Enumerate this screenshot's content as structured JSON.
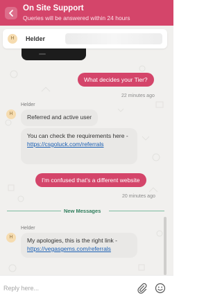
{
  "header": {
    "title": "On Site Support",
    "subtitle": "Queries will be answered within 24 hours",
    "back_icon": "chevron-left-icon",
    "background": "#d4456a"
  },
  "agent_card": {
    "initial": "H",
    "name": "Helder"
  },
  "messages": [
    {
      "direction": "outgoing",
      "text": "What decides your Tier?",
      "time": "22 minutes ago"
    },
    {
      "direction": "incoming",
      "sender": "Helder",
      "avatar": "H",
      "text": "Referred and active user"
    },
    {
      "direction": "incoming",
      "text": "You can check the requirements here -",
      "link": "https://csgoluck.com/referrals"
    },
    {
      "direction": "outgoing",
      "text": "I'm confused that's a different website",
      "time": "20 minutes ago"
    },
    {
      "direction": "incoming",
      "sender": "Helder",
      "avatar": "H",
      "text": "My apologies, this is the right link -",
      "link": "https://vegasgems.com/referrals"
    }
  ],
  "divider": {
    "label": "New Messages",
    "color": "#2e7d5b"
  },
  "composer": {
    "placeholder": "Reply here...",
    "attach_icon": "paperclip-icon",
    "emoji_icon": "smiley-icon"
  },
  "colors": {
    "accent": "#d4456a",
    "incoming_bubble": "#e9e8e6",
    "chat_background": "#f1f0ee",
    "link": "#1a5fb4"
  }
}
